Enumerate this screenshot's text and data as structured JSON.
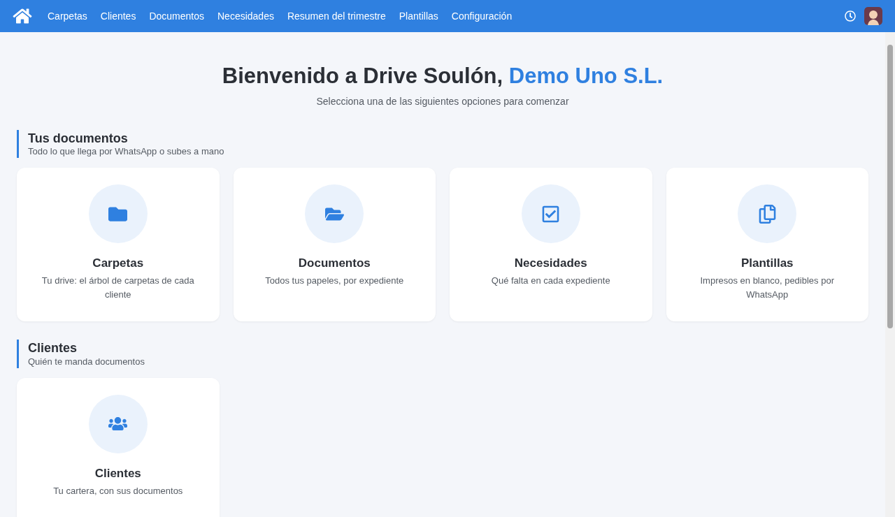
{
  "nav": {
    "items": [
      {
        "label": "Carpetas"
      },
      {
        "label": "Clientes"
      },
      {
        "label": "Documentos"
      },
      {
        "label": "Necesidades"
      },
      {
        "label": "Resumen del trimestre"
      },
      {
        "label": "Plantillas"
      },
      {
        "label": "Configuración"
      }
    ]
  },
  "hero": {
    "title": "Bienvenido a Drive Soulón,",
    "company": "Demo Uno S.L.",
    "subtitle": "Selecciona una de las siguientes opciones para comenzar"
  },
  "sections": [
    {
      "title": "Tus documentos",
      "subtitle": "Todo lo que llega por WhatsApp o subes a mano",
      "cards": [
        {
          "title": "Carpetas",
          "description": "Tu drive: el árbol de carpetas de cada cliente"
        },
        {
          "title": "Documentos",
          "description": "Todos tus papeles, por expediente"
        },
        {
          "title": "Necesidades",
          "description": "Qué falta en cada expediente"
        },
        {
          "title": "Plantillas",
          "description": "Impresos en blanco, pedibles por WhatsApp"
        }
      ]
    },
    {
      "title": "Clientes",
      "subtitle": "Quién te manda documentos",
      "cards": [
        {
          "title": "Clientes",
          "description": "Tu cartera, con sus documentos"
        }
      ]
    }
  ]
}
